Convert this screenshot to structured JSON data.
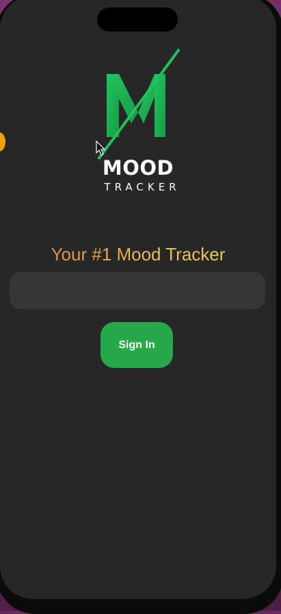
{
  "app": {
    "brand_main": "MOOD",
    "brand_sub": "TRACKER",
    "tagline": "Your #1 Mood Tracker"
  },
  "form": {
    "input_value": "",
    "input_placeholder": "",
    "signin_label": "Sign In"
  },
  "colors": {
    "screen_background": "#272727",
    "accent_green": "#27a84a",
    "logo_green": "#1fb85a",
    "input_background": "#373737",
    "tagline_start": "#d97a3e",
    "tagline_end": "#e9cf5c"
  },
  "icons": {
    "logo": "mood-tracker-logo-icon",
    "pointer": "mouse-pointer-icon"
  }
}
